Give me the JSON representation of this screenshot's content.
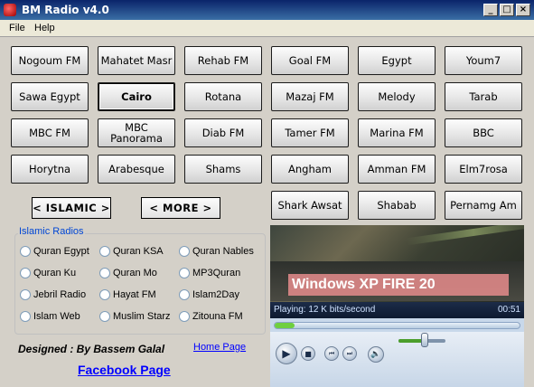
{
  "window": {
    "title": "BM Radio v4.0",
    "buttons": {
      "minimize": "_",
      "maximize": "□",
      "close": "×"
    }
  },
  "menu": {
    "file": "File",
    "help": "Help"
  },
  "stations": [
    "Nogoum FM",
    "Mahatet Masr",
    "Rehab FM",
    "Goal FM",
    "Egypt",
    "Youm7",
    "Sawa Egypt",
    "Cairo",
    "Rotana",
    "Mazaj FM",
    "Melody",
    "Tarab",
    "MBC FM",
    "MBC Panorama",
    "Diab FM",
    "Tamer FM",
    "Marina FM",
    "BBC",
    "Horytna",
    "Arabesque",
    "Shams",
    "Angham",
    "Amman FM",
    "Elm7rosa",
    "Shark Awsat",
    "Shabab",
    "Pernamg Am"
  ],
  "active_station": "Cairo",
  "nav": {
    "islamic": "< ISLAMIC >",
    "more": "< MORE >"
  },
  "islamic_radios": {
    "title": "Islamic Radios",
    "options": [
      "Quran Egypt",
      "Quran KSA",
      "Quran Nables",
      "Quran Ku",
      "Quran Mo",
      "MP3Quran",
      "Jebril Radio",
      "Hayat FM",
      "Islam2Day",
      "Islam Web",
      "Muslim Starz",
      "Zitouna FM"
    ]
  },
  "credits": {
    "designed_by": "Designed : By Bassem Galal",
    "home_page": "Home Page",
    "facebook_page": "Facebook Page"
  },
  "player": {
    "overlay_text": "Windows XP FIRE 20",
    "status": "Playing: 12 K bits/second",
    "time": "00:51",
    "seek_progress": 0.08,
    "volume_level": 0.55,
    "icons": {
      "play": "play-icon",
      "stop": "stop-icon",
      "prev": "previous-icon",
      "next": "next-icon",
      "mute": "speaker-icon"
    }
  }
}
